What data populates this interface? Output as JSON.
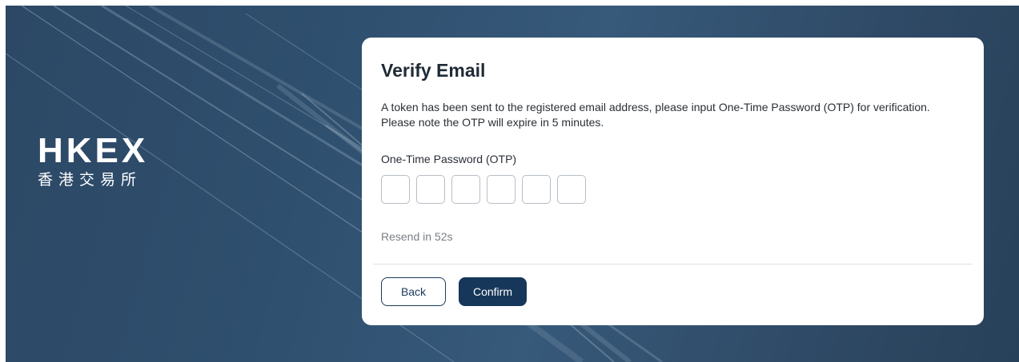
{
  "brand": {
    "logo_text": "HKEX",
    "logo_chinese": "香港交易所"
  },
  "dialog": {
    "title": "Verify Email",
    "description": "A token has been sent to the registered email address, please input One-Time Password (OTP) for verification. Please note the OTP will expire in 5 minutes.",
    "otp_label": "One-Time Password (OTP)",
    "otp_digits": [
      "",
      "",
      "",
      "",
      "",
      ""
    ],
    "resend_text": "Resend in 52s",
    "back_label": "Back",
    "confirm_label": "Confirm"
  },
  "colors": {
    "primary": "#17375a",
    "background": "#2f4f6e"
  }
}
